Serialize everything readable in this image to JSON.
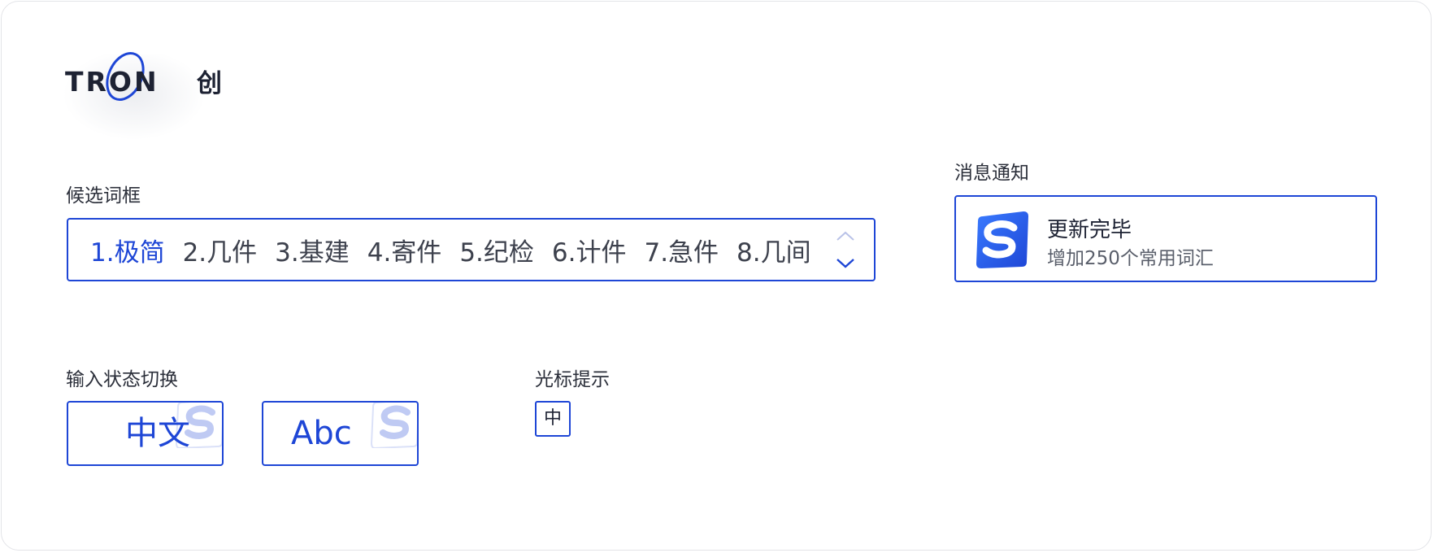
{
  "brand": {
    "logo_text": "TRON",
    "logo_cn": "创",
    "accent": "#1e46d6"
  },
  "candidate": {
    "label": "候选词框",
    "items": [
      "1.极简",
      "2.几件",
      "3.基建",
      "4.寄件",
      "5.纪检",
      "6.计件",
      "7.急件",
      "8.几间"
    ],
    "active_index": 0
  },
  "notification": {
    "label": "消息通知",
    "title": "更新完毕",
    "description": "增加250个常用词汇",
    "icon": "sogou-s-icon"
  },
  "input_state": {
    "label": "输入状态切换",
    "chinese": "中文",
    "english": "Abc"
  },
  "cursor_hint": {
    "label": "光标提示",
    "value": "中"
  }
}
